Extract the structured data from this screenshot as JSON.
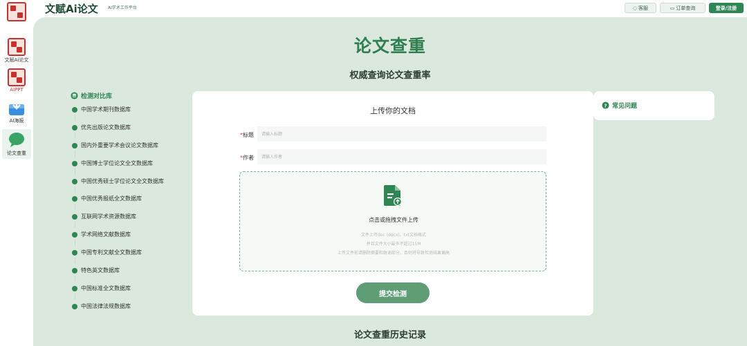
{
  "header": {
    "brand": "文赋Ai论文",
    "brand_sub": "AI学术工作平台",
    "kefu_label": "客服",
    "order_label": "订单查询",
    "login_label": "登录/注册"
  },
  "sidebar": {
    "items": [
      {
        "label": "文赋Ai论文",
        "icon": "seal-logo-icon"
      },
      {
        "label": "AIPPT",
        "icon": "seal-logo-icon"
      },
      {
        "label": "AI海报",
        "icon": "download-box-icon"
      },
      {
        "label": "论文查重",
        "icon": "chat-bubble-icon"
      }
    ]
  },
  "main": {
    "title": "论文查重",
    "subtitle": "权威查询论文查重率",
    "history_title": "论文查重历史记录"
  },
  "databases": {
    "title": "检测对比库",
    "items": [
      "中国学术期刊数据库",
      "优先出版论文数据库",
      "国内外重要学术会议论文数据库",
      "中国博士学位论文全文数据库",
      "中国优秀硕士学位论文全文数据库",
      "中国优秀报纸全文数据库",
      "互联网学术资源数据库",
      "学术网络文献数据库",
      "中国专利文献全文数据库",
      "特色英文数据库",
      "中国标准全文数据库",
      "中国法律法规数据库"
    ]
  },
  "upload": {
    "title": "上传你的文档",
    "title_label": "标题",
    "title_placeholder": "请输入标题",
    "author_label": "作者",
    "author_placeholder": "请输入作者",
    "drop_label": "点击或拖拽文件上传",
    "notes": [
      "文件上传doc (docx)、txt文档格式",
      "并且文件大小最多不超过15M",
      "上传文件前请删除摘要和致谢部分，否则将导致检测结果偏高"
    ],
    "submit_label": "提交检测"
  },
  "faq": {
    "title": "常见问题"
  },
  "colors": {
    "accent": "#2e8654",
    "panel_bg": "#dbe8de",
    "required": "#e0423a"
  }
}
